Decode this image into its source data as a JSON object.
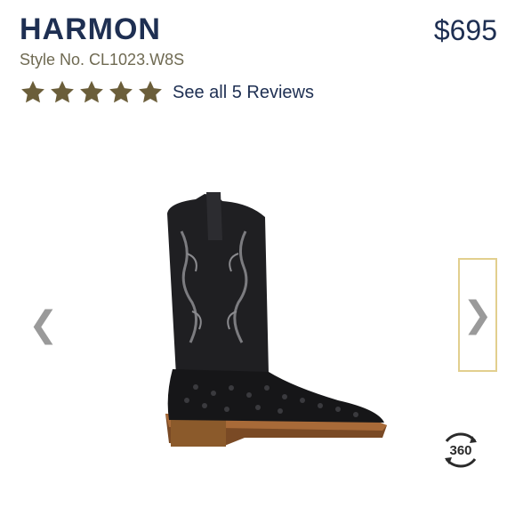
{
  "product": {
    "name": "HARMON",
    "price": "$695",
    "style_number": "Style No. CL1023.W8S"
  },
  "rating": {
    "stars": 5,
    "max_stars": 5,
    "star_color": "#6b5e3a",
    "reviews_link": "See all 5 Reviews"
  },
  "gallery": {
    "prev_icon": "chevron-left-icon",
    "next_icon": "chevron-right-icon",
    "prev_glyph": "❮",
    "next_glyph": "❯",
    "view_360_label": "360",
    "view_360_icon": "rotate-360-icon"
  },
  "colors": {
    "brand_navy": "#1e2f52",
    "style_text": "#6f6a52",
    "frame_border": "#e2cf8e"
  }
}
